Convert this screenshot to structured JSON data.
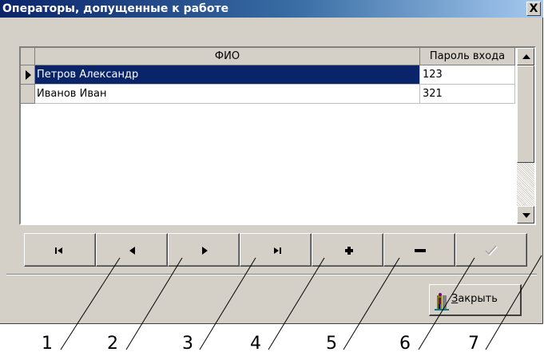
{
  "window": {
    "title": "Операторы, допущенные к работе",
    "close_glyph": "X"
  },
  "grid": {
    "columns": [
      "ФИО",
      "Пароль входа"
    ],
    "rows": [
      {
        "fio": "Петров Александр",
        "password": "123",
        "selected": true
      },
      {
        "fio": "Иванов Иван",
        "password": "321",
        "selected": false
      }
    ]
  },
  "navigator": {
    "buttons": [
      {
        "name": "first",
        "icon": "first-record-icon",
        "enabled": true
      },
      {
        "name": "prior",
        "icon": "prior-record-icon",
        "enabled": true
      },
      {
        "name": "next",
        "icon": "next-record-icon",
        "enabled": true
      },
      {
        "name": "last",
        "icon": "last-record-icon",
        "enabled": true
      },
      {
        "name": "insert",
        "icon": "plus-icon",
        "enabled": true
      },
      {
        "name": "delete",
        "icon": "minus-icon",
        "enabled": true
      },
      {
        "name": "post",
        "icon": "checkmark-icon",
        "enabled": false
      }
    ]
  },
  "close_button": {
    "accel": "З",
    "label_rest": "акрыть",
    "icon": "exit-door-icon"
  },
  "callouts": [
    "1",
    "2",
    "3",
    "4",
    "5",
    "6",
    "7"
  ]
}
